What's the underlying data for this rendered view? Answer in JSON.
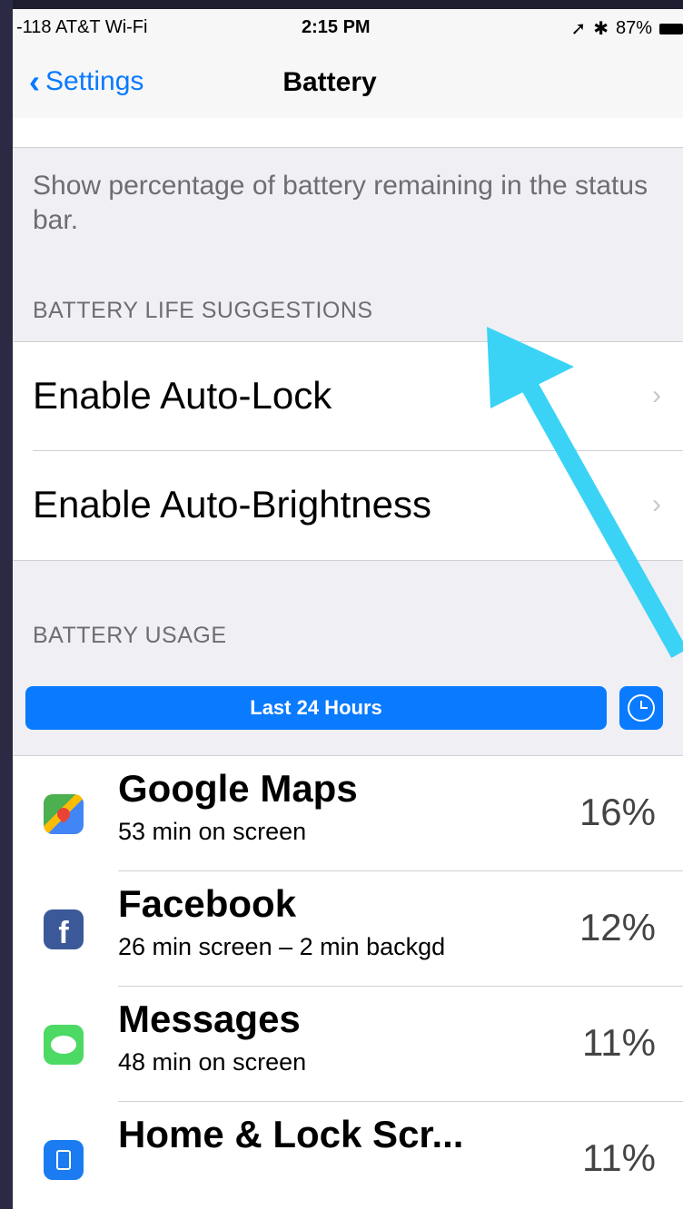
{
  "status_bar": {
    "carrier": "-118 AT&T Wi-Fi",
    "wifi_icon": "wifi-icon",
    "time": "2:15 PM",
    "right_icons": "location-icon bluetooth-icon",
    "battery_percent": "87%"
  },
  "nav": {
    "back_label": "Settings",
    "title": "Battery"
  },
  "battery_percentage": {
    "footer": "Show percentage of battery remaining in the status bar."
  },
  "suggestions": {
    "header": "BATTERY LIFE SUGGESTIONS",
    "items": [
      {
        "label": "Enable Auto-Lock"
      },
      {
        "label": "Enable Auto-Brightness"
      }
    ]
  },
  "usage": {
    "header": "BATTERY USAGE",
    "segment_label": "Last 24 Hours",
    "clock_icon": "clock-icon",
    "apps": [
      {
        "name": "Google Maps",
        "detail": "53 min on screen",
        "percent": "16%",
        "icon": "google-maps-icon"
      },
      {
        "name": "Facebook",
        "detail": "26 min screen – 2 min backgd",
        "percent": "12%",
        "icon": "facebook-icon"
      },
      {
        "name": "Messages",
        "detail": "48 min on screen",
        "percent": "11%",
        "icon": "messages-icon"
      },
      {
        "name": "Home & Lock Scr...",
        "detail": "",
        "percent": "11%",
        "icon": "home-lock-screen-icon"
      }
    ]
  },
  "colors": {
    "accent": "#0a7aff",
    "annotation_arrow": "#3ad3f5"
  }
}
